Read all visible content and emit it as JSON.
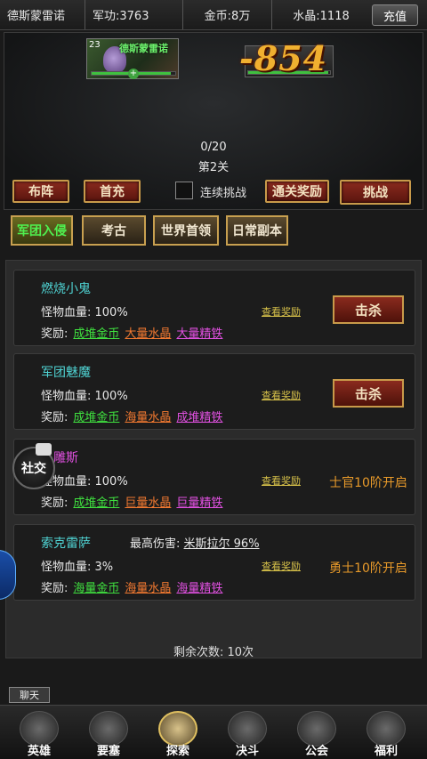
{
  "topbar": {
    "player_name": "德斯蒙雷诺",
    "merit": "军功:3763",
    "gold": "金币:8万",
    "crystal": "水晶:1118",
    "recharge": "充值"
  },
  "battle": {
    "hero_level": "23",
    "hero_name": "德斯蒙雷诺",
    "hero_hp_fraction": 0.95,
    "enemy_hp_fraction": 0.98,
    "damage": "-854",
    "progress": "0/20",
    "stage": "第2关"
  },
  "actions": {
    "formation": "布阵",
    "first_recharge": "首充",
    "auto_label": "连续挑战",
    "clear_reward": "通关奖励",
    "challenge": "挑战"
  },
  "tabs": [
    "军团入侵",
    "考古",
    "世界首领",
    "日常副本"
  ],
  "monsters": [
    {
      "name": "燃烧小鬼",
      "hp": "怪物血量: 100%",
      "reward_label": "奖励:",
      "rewards": [
        "成堆金币",
        "大量水晶",
        "大量精铁"
      ],
      "view": "查看奖励",
      "action": "击杀"
    },
    {
      "name": "军团魅魔",
      "hp": "怪物血量: 100%",
      "reward_label": "奖励:",
      "rewards": [
        "成堆金币",
        "海量水晶",
        "成堆精铁"
      ],
      "view": "查看奖励",
      "action": "击杀"
    },
    {
      "name": "…雕斯",
      "hp": "怪物血量: 100%",
      "reward_label": "奖励:",
      "rewards": [
        "成堆金币",
        "巨量水晶",
        "巨量精铁"
      ],
      "view": "查看奖励",
      "locked": "士官10阶开启"
    },
    {
      "name": "索克雷萨",
      "max_damage_label": "最高伤害:",
      "max_damage_value": "米斯拉尔 96%",
      "hp": "怪物血量: 3%",
      "reward_label": "奖励:",
      "rewards": [
        "海量金币",
        "海量水晶",
        "海量精铁"
      ],
      "view": "查看奖励",
      "locked": "勇士10阶开启"
    }
  ],
  "remaining": "剩余次数: 10次",
  "social": "社交",
  "chat": "聊天",
  "nav": [
    "英雄",
    "要塞",
    "探索",
    "决斗",
    "公会",
    "福利"
  ],
  "colors": {
    "accent_green": "#3fe03f",
    "accent_orange": "#f07830",
    "accent_pink": "#e050e0",
    "locked_text": "#e89a2a"
  }
}
